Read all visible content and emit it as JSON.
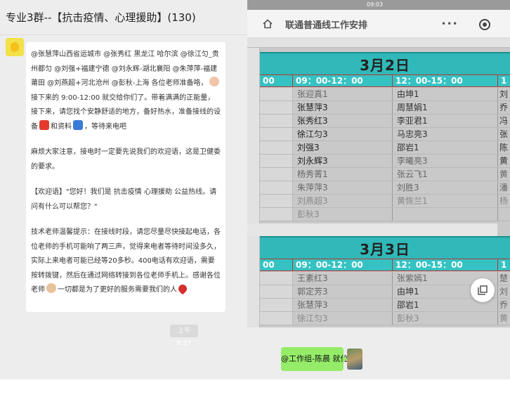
{
  "chat": {
    "title": "专业3群--【抗击疫情、心理援助】(130)",
    "sender_name": "",
    "message": {
      "p1_a": "@张慧萍山西省运城市 @张秀红 黑龙江 哈尔滨 @徐江匀_贵州都匀 @刘强+福建宁德 @刘永辉-湖北襄阳 @朱萍萍-福建莆田 @刘燕超+河北沧州 @彭秋-上海 各位老师准备咯，",
      "p1_b": "接下来的 9:00-12:00 就交给你们了。带着满满的正能量，接下来，请您找个安静舒适的地方，备好热水，准备接线的设备",
      "p1_c": "和资料",
      "p1_d": "，等待来电吧",
      "p2": "麻烦大家注意，接电时一定要先说我们的欢迎语，这是卫健委的要求。",
      "p3": "【欢迎语】\"您好！我们是 抗击疫情 心理援助 公益热线。请问有什么可以帮您？\"",
      "p4_a": "技术老师温馨提示：在接线时段，请您尽量尽快接起电话，各位老师的手机可能响了两三声，觉得来电者等待时间没多久，实际上来电者可能已经等20多秒。400电话有欢迎语，需要按转拨键，然后在通过网络转接到各位老师手机上。感谢各位老师",
      "p4_b": "一切都是为了更好的服务需要我们的人"
    },
    "timestamp": "上午 8:57",
    "my_message": "@工作组-陈晨 就位"
  },
  "sheet": {
    "status_left": "",
    "status_time": "09:03",
    "status_right": "",
    "nav_title": "联通普通线工作安排",
    "more_label": "•••",
    "blocks": [
      {
        "date": "3月2日",
        "times": [
          "00",
          "09：00-12：00",
          "12：00-15：00",
          "1"
        ],
        "rows": [
          [
            "",
            "张迎真1",
            "由坤1",
            "刘"
          ],
          [
            "",
            "张慧萍3",
            "周慧娟1",
            "乔"
          ],
          [
            "",
            "张秀红3",
            "李亚君1",
            "冯"
          ],
          [
            "",
            "徐江匀3",
            "马忠亮3",
            "张"
          ],
          [
            "",
            "刘强3",
            "邵岩1",
            "陈"
          ],
          [
            "",
            "刘永辉3",
            "李曦亮3",
            "黄"
          ],
          [
            "",
            "杨秀菁1",
            "张云飞1",
            "黄"
          ],
          [
            "",
            "朱萍萍3",
            "刘胜3",
            "潘"
          ],
          [
            "",
            "刘燕超3",
            "黄恢兰1",
            "杨"
          ],
          [
            "",
            "彭秋3",
            "",
            ""
          ]
        ]
      },
      {
        "date": "3月3日",
        "times": [
          "00",
          "09：00-12：00",
          "12：00-15：00",
          "1"
        ],
        "rows": [
          [
            "",
            "王素红3",
            "张紫嫣1",
            "楚"
          ],
          [
            "",
            "郭定芳3",
            "由坤1",
            "刘"
          ],
          [
            "",
            "张慧萍3",
            "邵岩1",
            "乔"
          ],
          [
            "",
            "徐江匀3",
            "彭秋3",
            "黄"
          ]
        ]
      }
    ]
  },
  "colors": {
    "sheet_header": "#31b8b8",
    "chat_bg": "#ededed",
    "my_bubble": "#95ec69",
    "heart": "#d32f2f"
  },
  "icons": [
    "avatar-icon",
    "girl-emoji-icon",
    "phone-emoji-icon",
    "computer-emoji-icon",
    "pray-emoji-icon",
    "heart-emoji-icon",
    "home-icon",
    "more-icon",
    "target-icon",
    "share-icon"
  ]
}
